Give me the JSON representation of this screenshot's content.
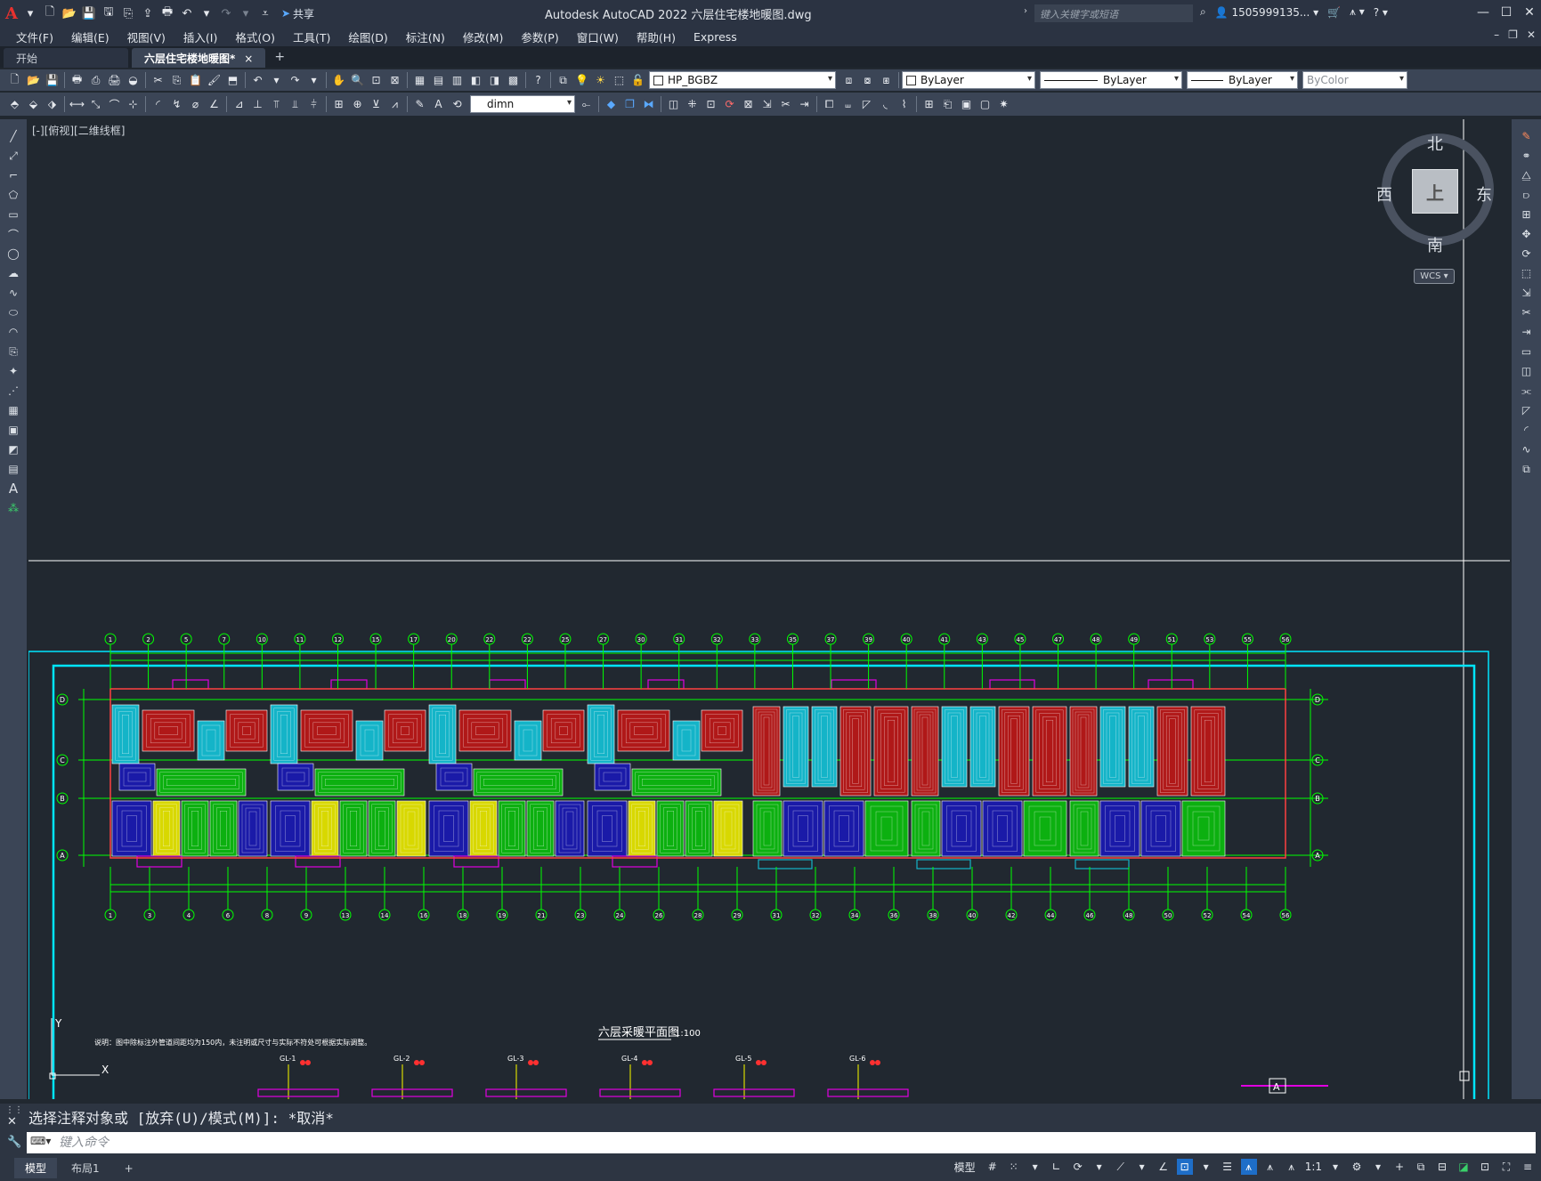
{
  "app": {
    "title": "Autodesk AutoCAD 2022    六层住宅楼地暖图.dwg",
    "share_label": "共享",
    "search_placeholder": "键入关键字或短语",
    "user_name": "1505999135...",
    "logo_letter": "A"
  },
  "menu": [
    "文件(F)",
    "编辑(E)",
    "视图(V)",
    "插入(I)",
    "格式(O)",
    "工具(T)",
    "绘图(D)",
    "标注(N)",
    "修改(M)",
    "参数(P)",
    "窗口(W)",
    "帮助(H)",
    "Express"
  ],
  "doc_tabs": {
    "start": "开始",
    "active": "六层住宅楼地暖图*",
    "close": "×",
    "add": "+"
  },
  "toolbar": {
    "layer_name": "HP_BGBZ",
    "color": "ByLayer",
    "linetype": "ByLayer",
    "lineweight": "ByLayer",
    "plotstyle": "ByColor",
    "dimstyle": "dimn"
  },
  "viewport": {
    "label": "[-][俯视][二维线框]",
    "compass": {
      "north": "北",
      "south": "南",
      "east": "东",
      "west": "西"
    },
    "cube_face": "上",
    "wcs": "WCS"
  },
  "drawing": {
    "title": "六层采暖平面图",
    "scale": "1:100",
    "note": "说明：图中除标注外管道间距均为150内，未注明或尺寸与实际不符处可根据实际调整。",
    "row_labels": [
      "D",
      "C",
      "B",
      "A"
    ],
    "top_axis": [
      "1",
      "2",
      "5",
      "7",
      "10",
      "11",
      "12",
      "15",
      "17",
      "20",
      "22",
      "22",
      "25",
      "27",
      "30",
      "31",
      "32",
      "33",
      "35",
      "37",
      "39",
      "40",
      "41",
      "43",
      "45",
      "47",
      "48",
      "49",
      "51",
      "53",
      "55",
      "56"
    ],
    "bottom_axis": [
      "1",
      "3",
      "4",
      "6",
      "8",
      "9",
      "13",
      "14",
      "16",
      "18",
      "19",
      "21",
      "23",
      "24",
      "26",
      "28",
      "29",
      "31",
      "32",
      "34",
      "36",
      "38",
      "40",
      "42",
      "44",
      "46",
      "48",
      "50",
      "52",
      "54",
      "56"
    ],
    "section_mark": "A",
    "collector_labels": [
      "GL-1",
      "GL-2",
      "GL-3",
      "GL-4",
      "GL-5",
      "GL-6"
    ]
  },
  "command": {
    "history": "选择注释对象或 [放弃(U)/模式(M)]: *取消*",
    "placeholder": "键入命令"
  },
  "status": {
    "model_tab": "模型",
    "layout_tab": "布局1",
    "add_tab": "+",
    "model_label": "模型",
    "scale": "1:1"
  },
  "colors": {
    "accent": "#1e6ec8",
    "drawing_frame": "#00e5ff",
    "grid_green": "#00ff00",
    "zone_red": "#b01818",
    "zone_cyan": "#14b4c8",
    "zone_blue": "#1a1aa8",
    "zone_green": "#0cb010",
    "zone_yellow": "#d8d800",
    "magenta": "#e000e0"
  }
}
